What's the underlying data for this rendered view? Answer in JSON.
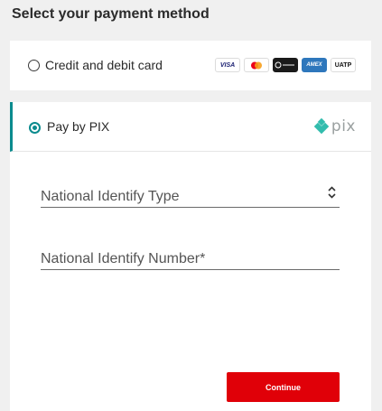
{
  "page": {
    "title": "Select your payment method"
  },
  "card_option": {
    "label": "Credit and debit card",
    "selected": false,
    "logos": [
      {
        "name": "visa",
        "text": "VISA"
      },
      {
        "name": "mastercard",
        "text": ""
      },
      {
        "name": "diners-club",
        "text": ""
      },
      {
        "name": "amex",
        "text": "AMEX"
      },
      {
        "name": "uatp",
        "text": "UATP"
      }
    ]
  },
  "pix_option": {
    "label": "Pay by PIX",
    "selected": true,
    "logo_text": "pix"
  },
  "form": {
    "id_type_placeholder": "National Identify Type",
    "id_number_placeholder": "National Identify Number*"
  },
  "actions": {
    "continue_label": "Continue"
  },
  "colors": {
    "accent": "#0b8b8e",
    "primary_button": "#e00008",
    "pix_logo": "#32bcad"
  }
}
